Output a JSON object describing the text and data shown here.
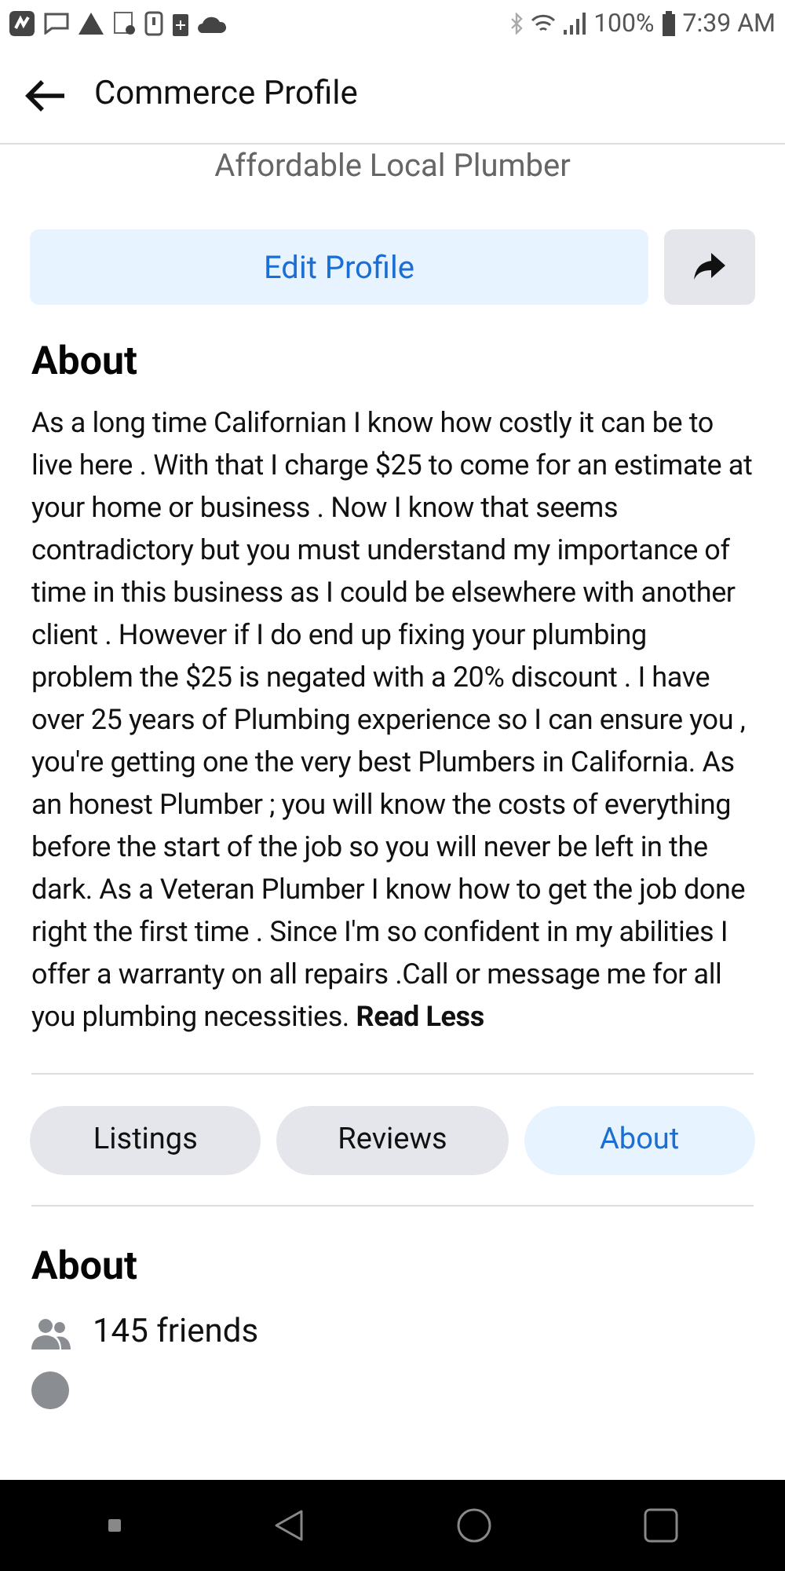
{
  "status_bar": {
    "battery": "100%",
    "time": "7:39 AM"
  },
  "header": {
    "title": "Commerce Profile"
  },
  "profile": {
    "subtitle": "Affordable Local Plumber",
    "edit_button": "Edit Profile"
  },
  "about": {
    "heading": "About",
    "text": "As a long time Californian I know how costly it can be to live here . With that I charge $25 to come for an estimate at your home or business . Now I know that seems contradictory but you must understand my importance of time in this business as I could be elsewhere with another client . However if I do end up fixing your plumbing problem the $25 is negated with a 20% discount . I have over 25 years of Plumbing experience so I can ensure you , you're getting one the very best Plumbers in California. As an honest Plumber ; you will know the costs of everything before the start of the job so you will never be left in the dark. As a Veteran Plumber I know how to get the job done right the first time . Since I'm so confident in my abilities I offer a warranty on all repairs .Call or message me for all you plumbing necessities.",
    "toggle_link": "Read Less"
  },
  "tabs": [
    {
      "label": "Listings",
      "selected": false
    },
    {
      "label": "Reviews",
      "selected": false
    },
    {
      "label": "About",
      "selected": true
    }
  ],
  "about_section": {
    "heading": "About",
    "friends": "145 friends"
  }
}
